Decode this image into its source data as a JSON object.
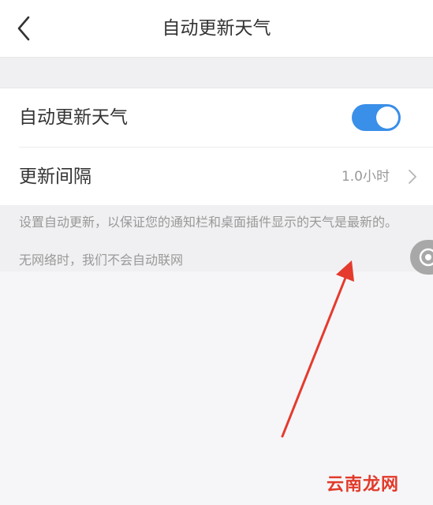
{
  "header": {
    "title": "自动更新天气",
    "back_icon": "chevron-left-icon"
  },
  "settings": {
    "auto_update": {
      "label": "自动更新天气",
      "enabled": true
    },
    "interval": {
      "label": "更新间隔",
      "value": "1.0小时"
    }
  },
  "note": {
    "line1": "设置自动更新，以保证您的通知栏和桌面插件显示的天气是最新的。",
    "line2": "无网络时，我们不会自动联网"
  },
  "colors": {
    "accent": "#3a8fe8",
    "annotation_arrow": "#e53a2e"
  },
  "watermark": "云南龙网"
}
